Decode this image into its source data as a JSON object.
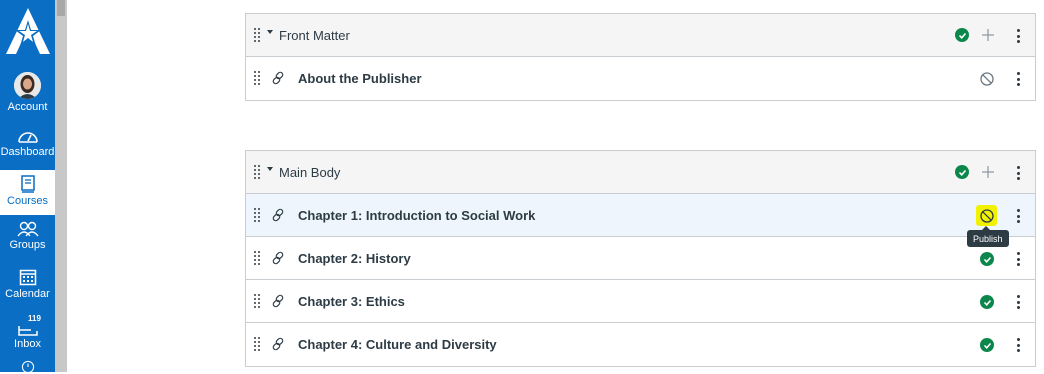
{
  "nav": {
    "account": "Account",
    "dashboard": "Dashboard",
    "courses": "Courses",
    "groups": "Groups",
    "calendar": "Calendar",
    "inbox": "Inbox",
    "inbox_badge": "119"
  },
  "modules": [
    {
      "title": "Front Matter",
      "published": true,
      "items": [
        {
          "title": "About the Publisher",
          "status": "unpublished"
        }
      ]
    },
    {
      "title": "Main Body",
      "published": true,
      "items": [
        {
          "title": "Chapter 1: Introduction to Social Work",
          "status": "unpublished",
          "highlighted": true
        },
        {
          "title": "Chapter 2: History",
          "status": "published"
        },
        {
          "title": "Chapter 3: Ethics",
          "status": "published"
        },
        {
          "title": "Chapter 4: Culture and Diversity",
          "status": "published"
        }
      ]
    }
  ],
  "tooltip": "Publish",
  "colors": {
    "nav": "#0a6ec5",
    "published": "#0b874b",
    "highlight": "#f2f200"
  }
}
